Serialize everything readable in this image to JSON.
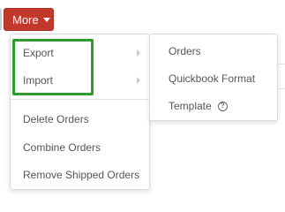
{
  "toolbar": {
    "more_label": "More",
    "more_color": "#c0392b"
  },
  "menu": {
    "items": [
      {
        "label": "Export",
        "has_submenu": true
      },
      {
        "label": "Import",
        "has_submenu": true
      },
      {
        "label": "Delete Orders"
      },
      {
        "label": "Combine Orders"
      },
      {
        "label": "Remove Shipped Orders"
      }
    ]
  },
  "submenu": {
    "items": [
      {
        "label": "Orders"
      },
      {
        "label": "Quickbook Format"
      },
      {
        "label": "Template",
        "icon": "help-icon",
        "icon_glyph": "?"
      }
    ]
  },
  "colors": {
    "highlight": "#2e9b2e",
    "menu_text": "#555555"
  }
}
